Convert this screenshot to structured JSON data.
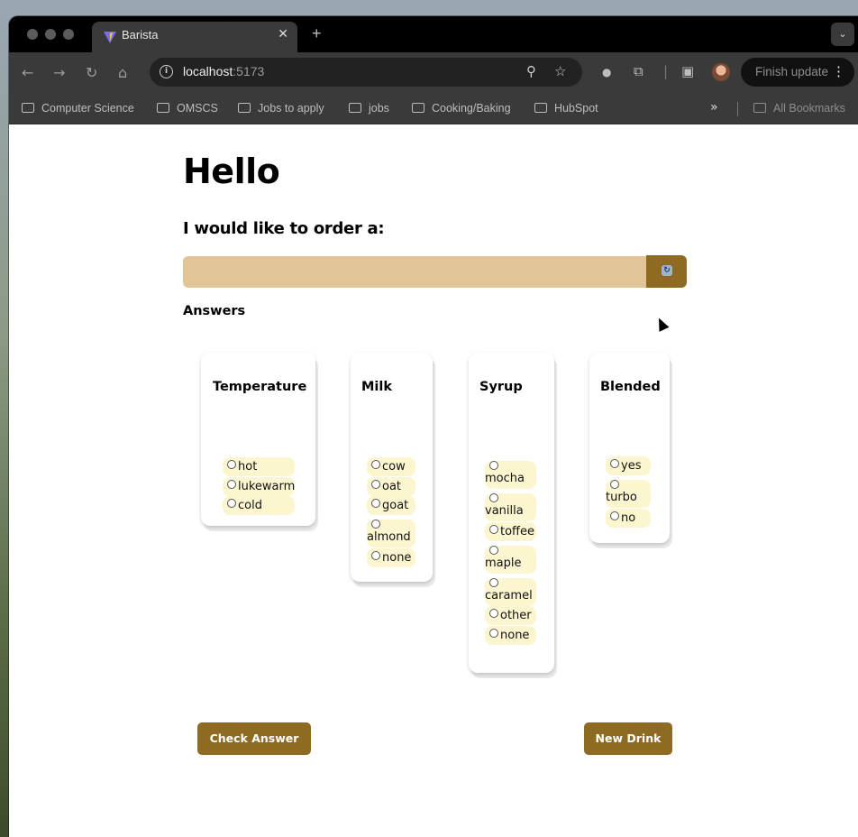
{
  "browser": {
    "tab_title": "Barista",
    "tab_close": "✕",
    "new_tab": "+",
    "url_host": "localhost",
    "url_port": ":5173",
    "finish_update": "Finish update",
    "bookmarks": [
      "Computer Science",
      "OMSCS",
      "Jobs to apply",
      "jobs",
      "Cooking/Baking",
      "HubSpot"
    ],
    "all_bookmarks": "All Bookmarks"
  },
  "page": {
    "heading": "Hello",
    "prompt": "I would like to order a:",
    "order_input_value": "",
    "answers_label": "Answers"
  },
  "cards": {
    "temperature": {
      "title": "Temperature",
      "options": [
        "hot",
        "lukewarm",
        "cold"
      ]
    },
    "milk": {
      "title": "Milk",
      "options": [
        "cow",
        "oat",
        "goat",
        "almond",
        "none"
      ]
    },
    "syrup": {
      "title": "Syrup",
      "options": [
        "mocha",
        "vanilla",
        "toffee",
        "maple",
        "caramel",
        "other",
        "none"
      ]
    },
    "blended": {
      "title": "Blended",
      "options": [
        "yes",
        "turbo",
        "no"
      ]
    }
  },
  "buttons": {
    "check_answer": "Check Answer",
    "new_drink": "New Drink"
  },
  "colors": {
    "accent_brown": "#8e6a23",
    "input_tan": "#e2c596",
    "option_cream": "#fbf6cf"
  }
}
